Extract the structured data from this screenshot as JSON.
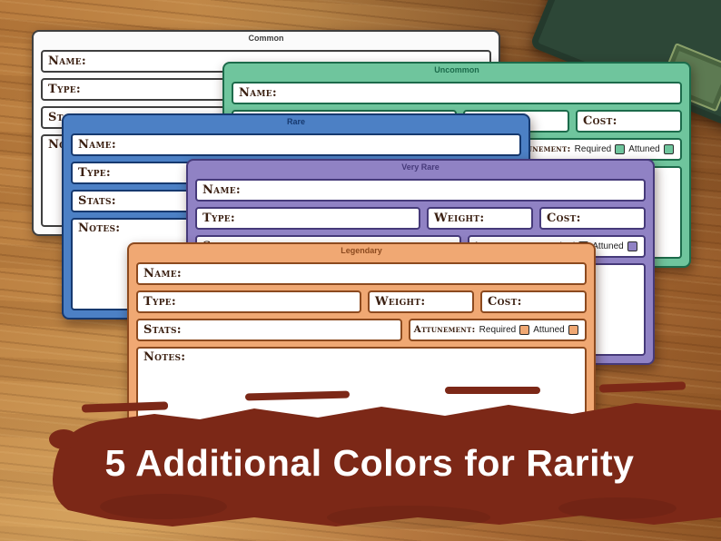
{
  "labels": {
    "name": "Name:",
    "type": "Type:",
    "weight": "Weight:",
    "cost": "Cost:",
    "stats": "Stats:",
    "attunement": "Attunement:",
    "required": "Required",
    "attuned": "Attuned",
    "notes": "Notes:"
  },
  "cards": [
    {
      "rarity": "Common",
      "body_color": "#fbfbfb",
      "border_color": "#3f3f3f",
      "checkbox_color": "#ececec"
    },
    {
      "rarity": "Uncommon",
      "body_color": "#6fc59d",
      "border_color": "#1c6b4b",
      "checkbox_color": "#6fc59d"
    },
    {
      "rarity": "Rare",
      "body_color": "#4c80c5",
      "border_color": "#16396f",
      "checkbox_color": "#4c80c5"
    },
    {
      "rarity": "Very Rare",
      "body_color": "#9082c4",
      "border_color": "#463a7a",
      "checkbox_color": "#9082c4"
    },
    {
      "rarity": "Legendary",
      "body_color": "#f0a873",
      "border_color": "#8c4a1f",
      "checkbox_color": "#f0a873"
    }
  ],
  "banner": {
    "text": "5 Additional Colors for Rarity",
    "background_color": "#7c2817",
    "text_color": "#ffffff"
  }
}
